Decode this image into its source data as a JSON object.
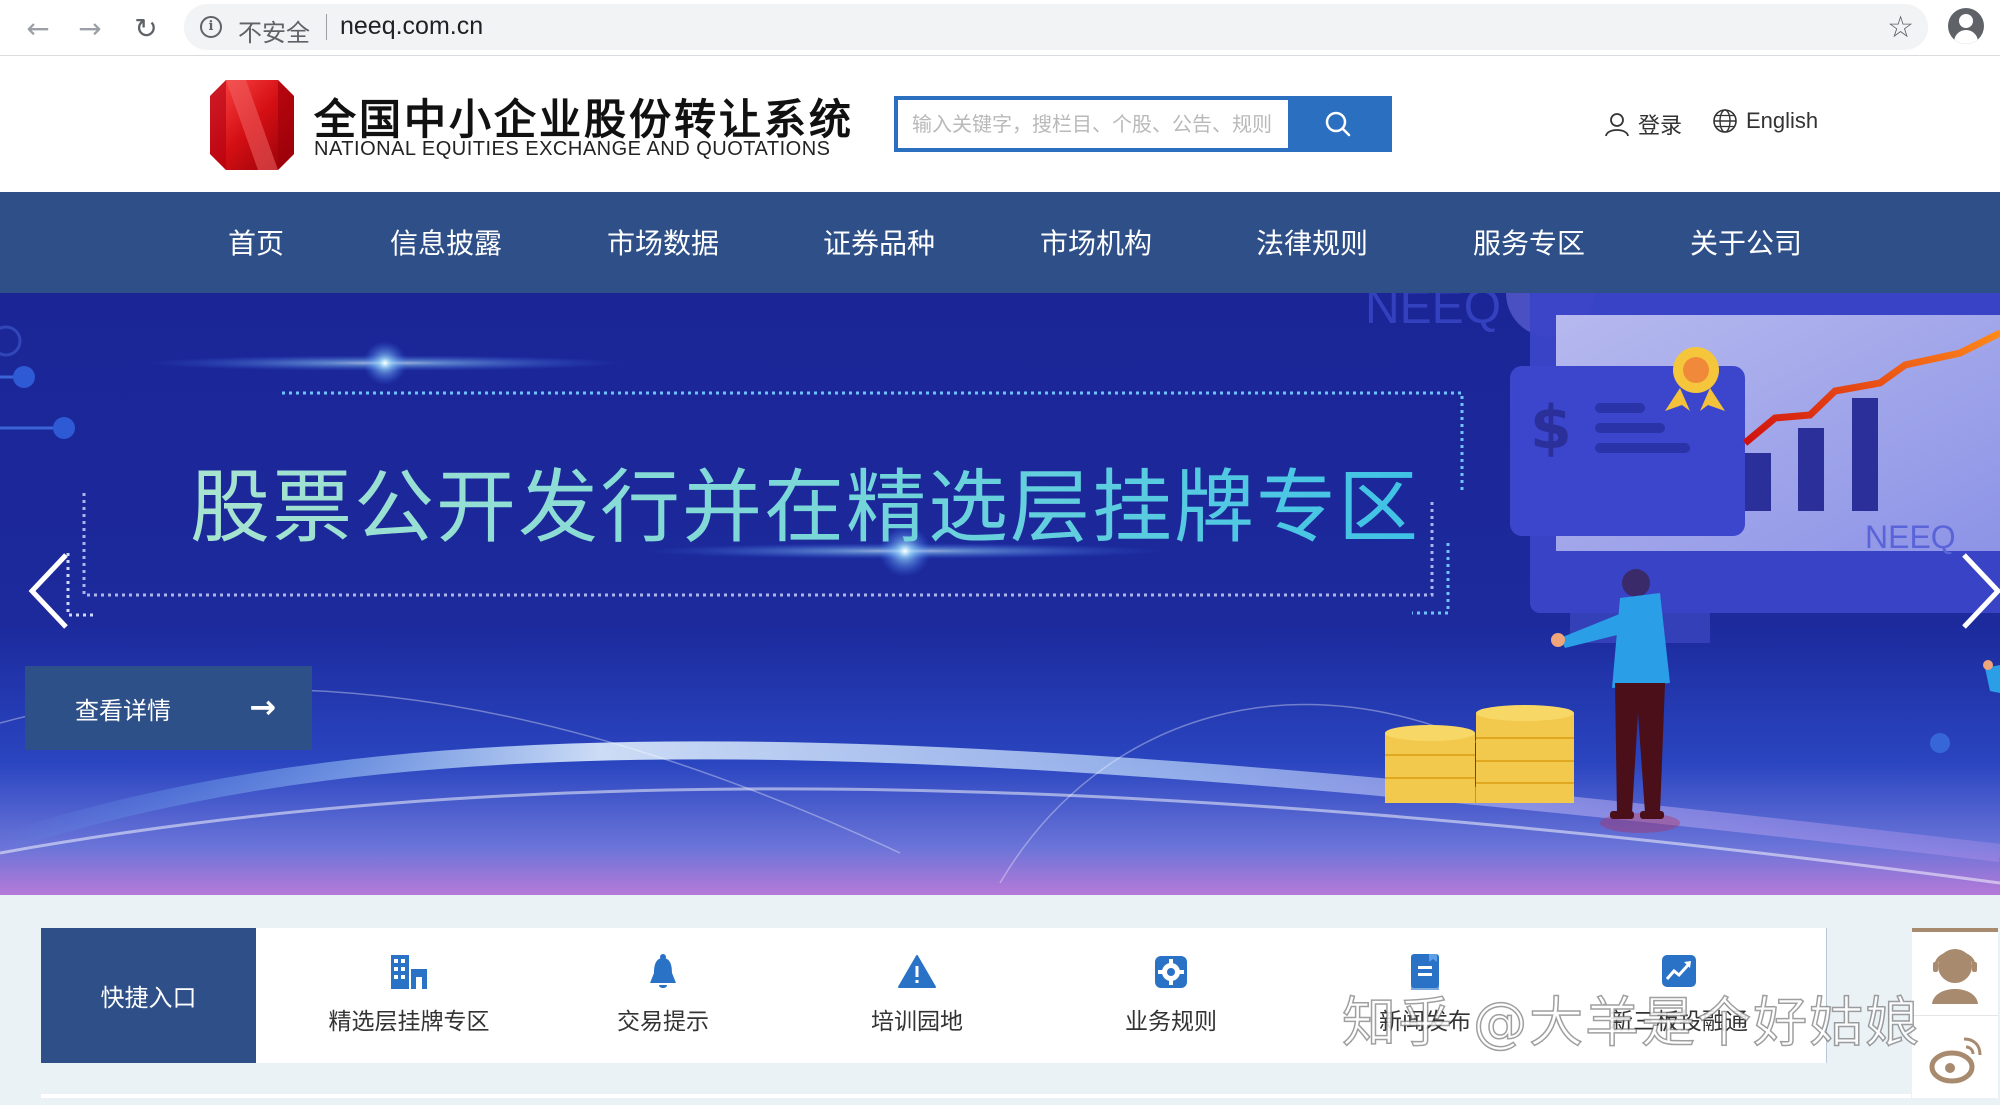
{
  "browser": {
    "back_icon": "arrow-left-icon",
    "forward_icon": "arrow-right-icon",
    "reload_icon": "reload-icon",
    "security_label": "不安全",
    "url": "neeq.com.cn",
    "bookmark_icon": "star-icon",
    "profile_icon": "account-circle-icon"
  },
  "header": {
    "logo_cn": "全国中小企业股份转让系统",
    "logo_en": "NATIONAL EQUITIES EXCHANGE AND QUOTATIONS",
    "search": {
      "placeholder": "输入关键字，搜栏目、个股、公告、规则",
      "value": "",
      "button_icon": "search-icon"
    },
    "login_label": "登录",
    "language_label": "English",
    "brand_color": "#2e4f87",
    "accent_color": "#2a6fc0"
  },
  "nav": {
    "items": [
      {
        "label": "首页"
      },
      {
        "label": "信息披露"
      },
      {
        "label": "市场数据"
      },
      {
        "label": "证券品种"
      },
      {
        "label": "市场机构"
      },
      {
        "label": "法律规则"
      },
      {
        "label": "服务专区"
      },
      {
        "label": "关于公司"
      }
    ]
  },
  "banner": {
    "title": "股票公开发行并在精选层挂牌专区",
    "watermark_text": "NEEQ",
    "detail_button_label": "查看详情",
    "detail_button_arrow": "→",
    "prev_icon": "chevron-left-icon",
    "next_icon": "chevron-right-icon"
  },
  "quick_entry": {
    "heading": "快捷入口",
    "items": [
      {
        "label": "精选层挂牌专区",
        "icon": "building-icon"
      },
      {
        "label": "交易提示",
        "icon": "bell-icon"
      },
      {
        "label": "培训园地",
        "icon": "warning-icon"
      },
      {
        "label": "业务规则",
        "icon": "gear-icon"
      },
      {
        "label": "新闻发布",
        "icon": "document-icon"
      },
      {
        "label": "新三板投融通",
        "icon": "trend-chart-icon"
      }
    ],
    "icon_color": "#2a72c6"
  },
  "float_panel": {
    "customer_service_icon": "customer-service-icon",
    "weibo_icon": "weibo-icon",
    "color": "#a88a6e"
  },
  "overlay_watermark": "知乎 @大羊是个好姑娘"
}
